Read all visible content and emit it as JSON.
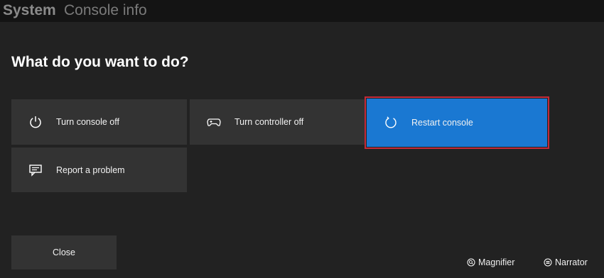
{
  "header": {
    "section": "System",
    "page": "Console info"
  },
  "dialog": {
    "title": "What do you want to do?"
  },
  "options": [
    {
      "label": "Turn console off",
      "icon": "power-icon"
    },
    {
      "label": "Turn controller off",
      "icon": "controller-icon"
    },
    {
      "label": "Restart console",
      "icon": "restart-icon",
      "selected": true
    },
    {
      "label": "Report a problem",
      "icon": "feedback-icon"
    }
  ],
  "close_label": "Close",
  "footer": {
    "magnifier_label": "Magnifier",
    "narrator_label": "Narrator"
  },
  "colors": {
    "background": "#222222",
    "tile": "#333333",
    "selected_tile": "#1a78d2",
    "focus_outline": "#c42a39"
  }
}
